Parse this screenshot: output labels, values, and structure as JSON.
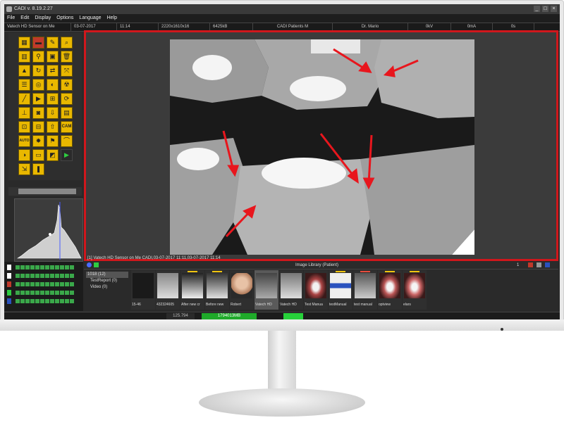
{
  "window": {
    "title": "CADI v. 8.19.2.27"
  },
  "menu": [
    "File",
    "Edit",
    "Display",
    "Options",
    "Language",
    "Help"
  ],
  "status": [
    "Vatech HD Sensor on Me",
    "03-07-2017",
    "11:14",
    "2220x1610x16",
    "6425kB",
    "CADI Patients M",
    "Dr. Mario",
    "0kV",
    "0mA",
    "0s"
  ],
  "tools": {
    "cam_label": "CAM",
    "auto_label": "AUTO"
  },
  "viewer": {
    "caption": "[1] Vatech HD Sensor on Me CADI,03-07-2017 11:11,03-07-2017 11:14"
  },
  "library": {
    "title": "Image Library (Patient)",
    "count": "1",
    "tree": [
      "1018 (12)",
      "TestReport (0)",
      "Video (0)"
    ],
    "thumbnails": [
      "15-46",
      "432324605",
      "After new cr",
      "Before new",
      "Robert",
      "Vatech HD",
      "Vatech HD",
      "Test Manua",
      "testManual",
      "test manual",
      "optview",
      "elars"
    ]
  },
  "bottom_status": {
    "left": "125.794",
    "memory": "1794013MB"
  },
  "colors": {
    "accent_red": "#d0171c",
    "tool_yellow": "#e9b800",
    "mem_green": "#1faa2a"
  }
}
